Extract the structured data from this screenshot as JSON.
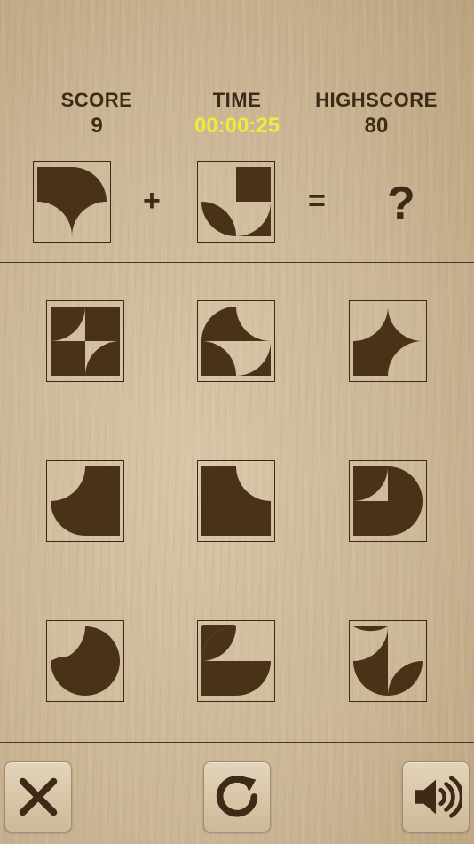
{
  "hud": {
    "score_label": "SCORE",
    "score_value": "9",
    "time_label": "TIME",
    "time_value": "00:00:25",
    "highscore_label": "HIGHSCORE",
    "highscore_value": "80"
  },
  "equation": {
    "plus": "+",
    "equals": "=",
    "unknown": "?"
  },
  "colors": {
    "shape": "#4a3219",
    "time_text": "#ecec3a",
    "board_text": "#3d2a17"
  },
  "footer": {
    "close_icon": "close-icon",
    "restart_icon": "restart-icon",
    "sound_icon": "sound-icon"
  }
}
